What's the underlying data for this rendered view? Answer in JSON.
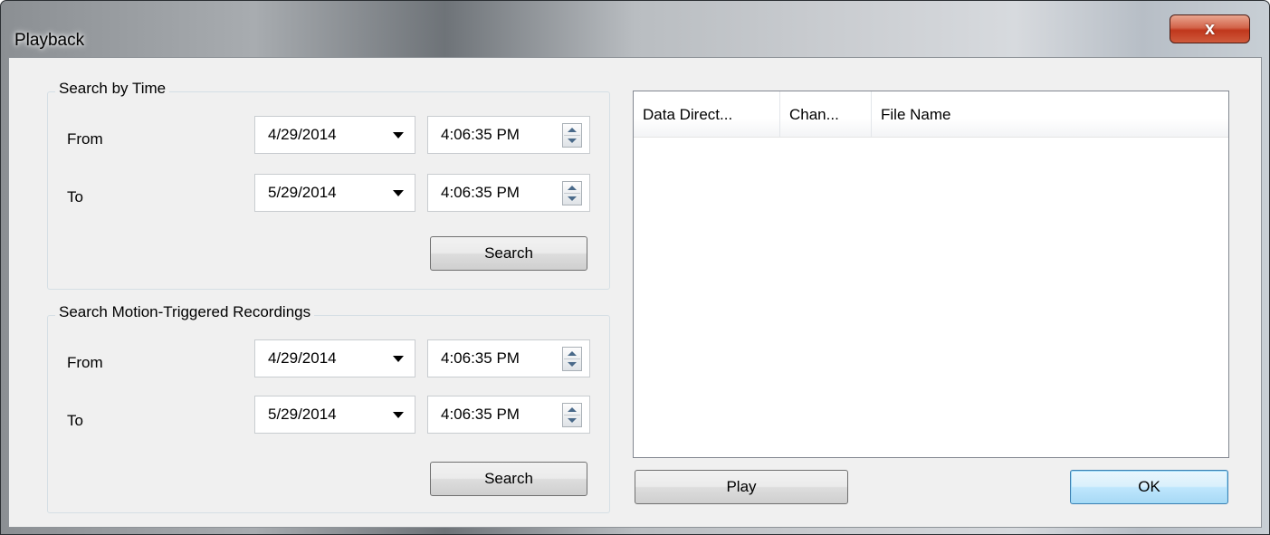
{
  "window": {
    "title": "Playback",
    "close_glyph": "x"
  },
  "search_by_time": {
    "title": "Search by Time",
    "from_label": "From",
    "from_date": "4/29/2014",
    "from_time": "4:06:35 PM",
    "to_label": "To",
    "to_date": "5/29/2014",
    "to_time": "4:06:35 PM",
    "search_label": "Search"
  },
  "search_motion": {
    "title": "Search Motion-Triggered Recordings",
    "from_label": "From",
    "from_date": "4/29/2014",
    "from_time": "4:06:35 PM",
    "to_label": "To",
    "to_date": "5/29/2014",
    "to_time": "4:06:35 PM",
    "search_label": "Search"
  },
  "results": {
    "columns": [
      "Data Direct...",
      "Chan...",
      "File Name"
    ],
    "rows": []
  },
  "buttons": {
    "play_label": "Play",
    "ok_label": "OK"
  },
  "icons": {
    "close": "close-icon",
    "dropdown": "chevron-down-icon",
    "spinner": "spinner-icon"
  },
  "colors": {
    "dialog_background": "#f0f0f0",
    "close_button": "#c7472b",
    "default_button_border": "#3c7fb1"
  }
}
